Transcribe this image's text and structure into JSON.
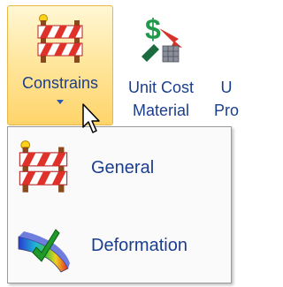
{
  "ribbon": {
    "constrains": {
      "label": "Constrains",
      "icon": "barricade-icon"
    },
    "unit_cost": {
      "line1": "Unit Cost",
      "line2": "Material",
      "icon": "unit-cost-material-icon"
    },
    "partial": {
      "line1": "U",
      "line2": "Pro"
    }
  },
  "menu": {
    "items": [
      {
        "label": "General",
        "icon": "barricade-icon"
      },
      {
        "label": "Deformation",
        "icon": "deformation-icon"
      }
    ]
  },
  "colors": {
    "label_blue": "#1a3e8f",
    "active_gradient_top": "#fff7d4",
    "active_gradient_bottom": "#ffd46a",
    "barricade_red": "#e0302a",
    "dollar_green": "#1f9a4a"
  }
}
